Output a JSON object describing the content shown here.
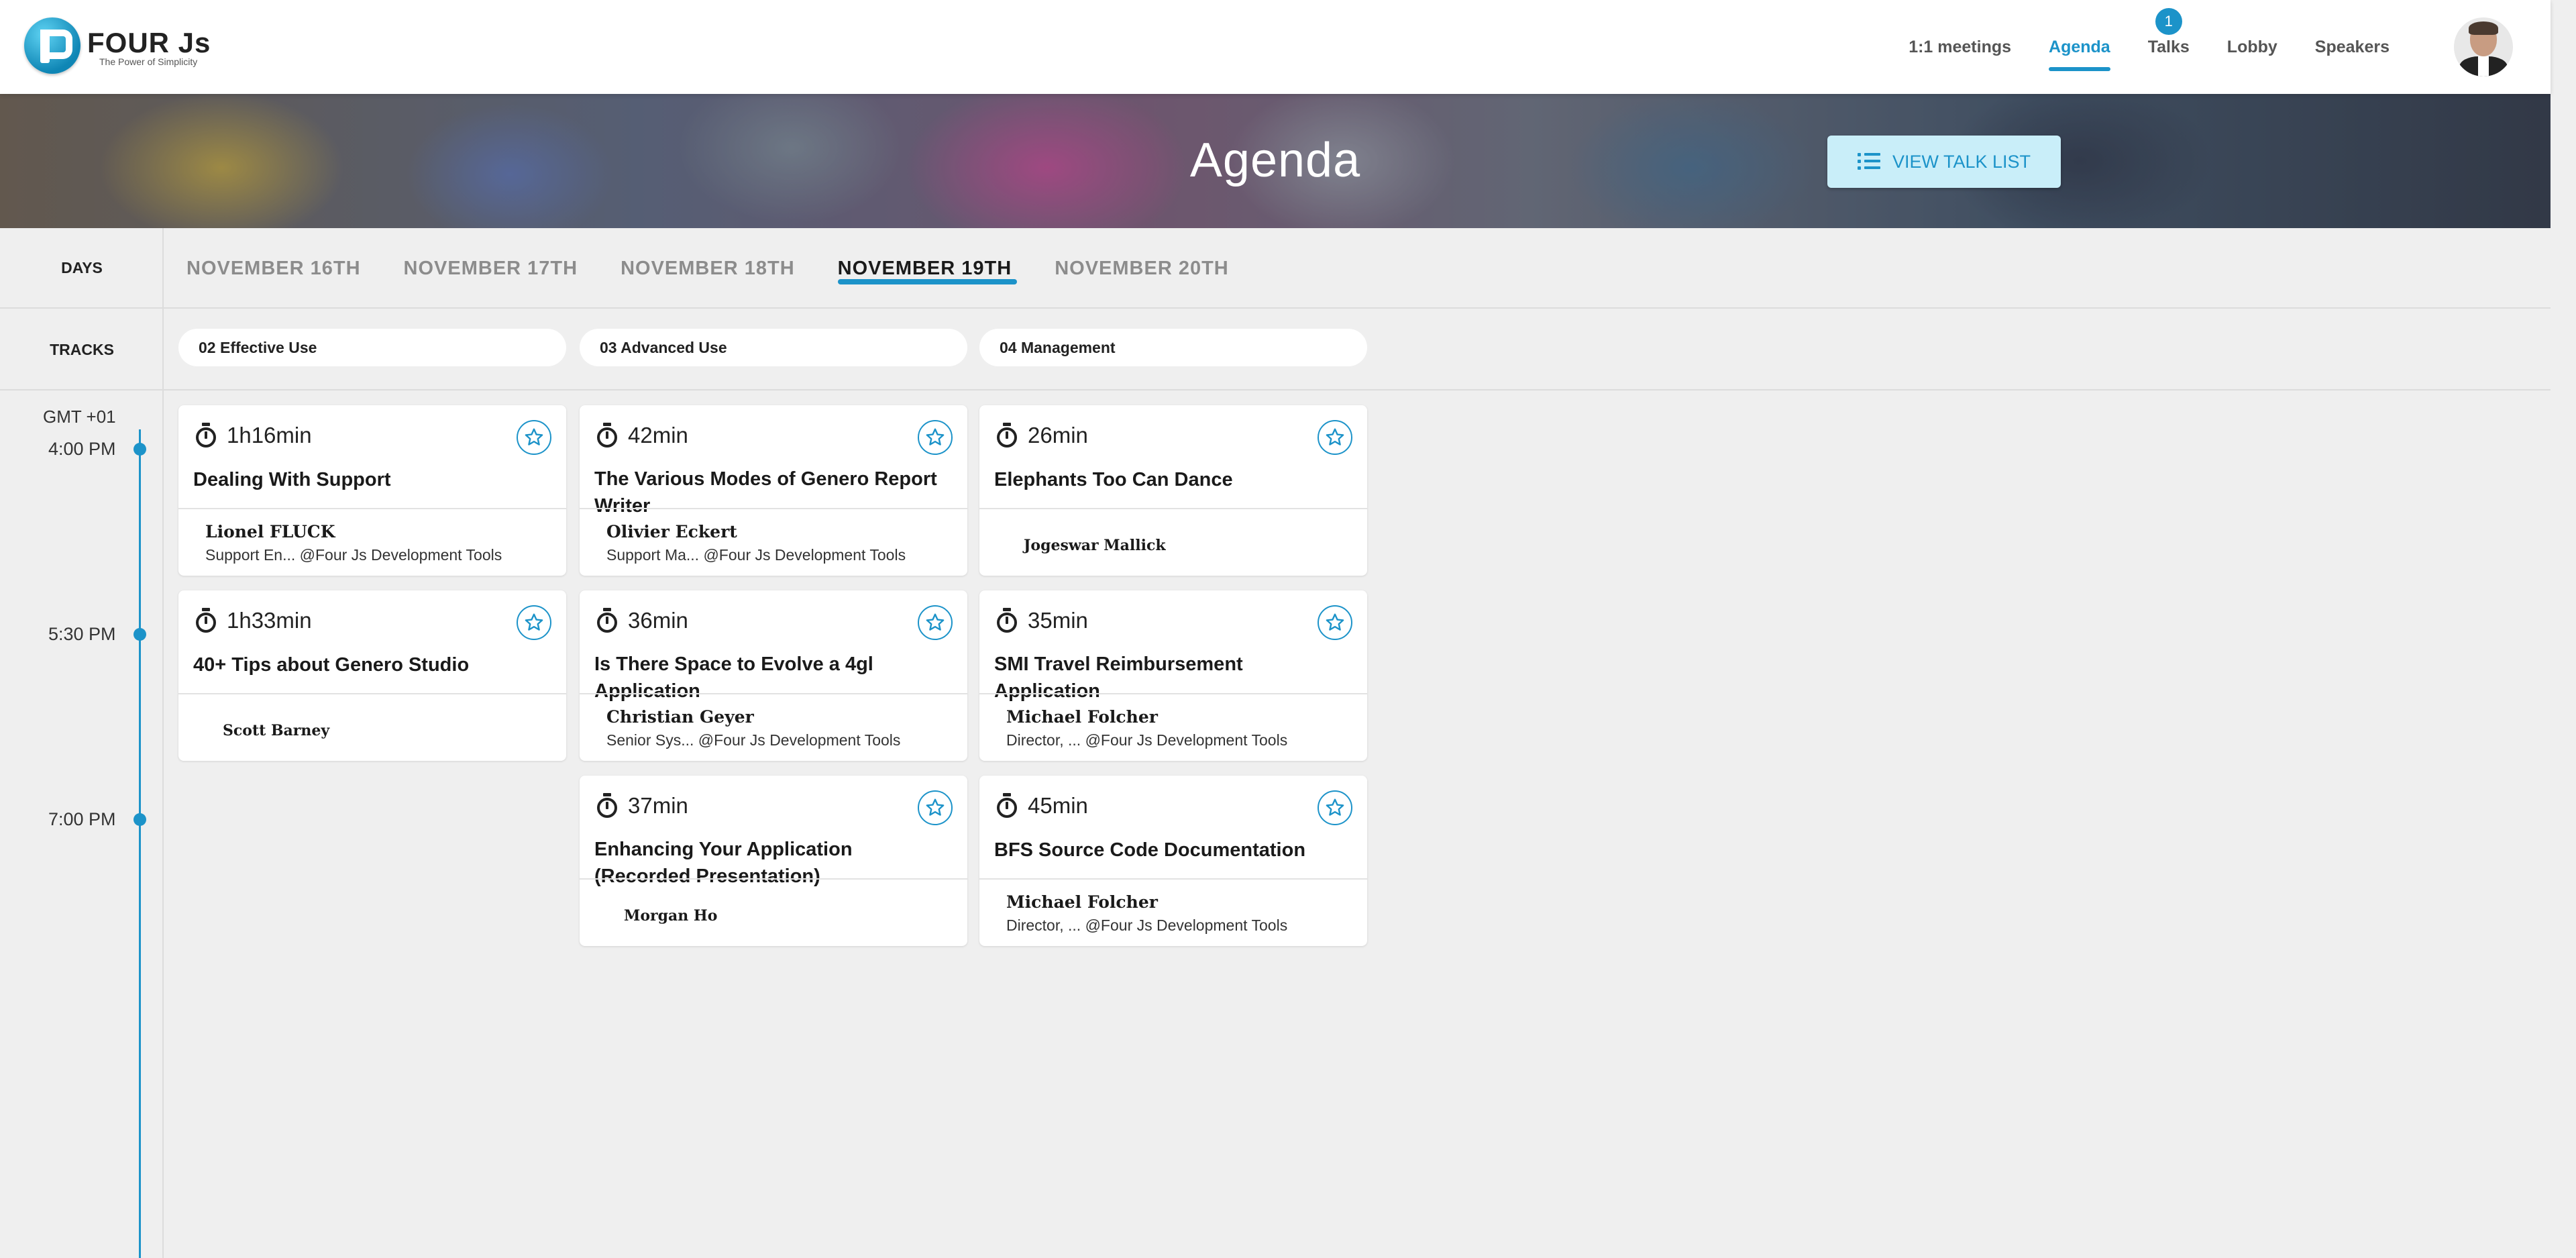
{
  "header": {
    "logo_text": "FOUR Js",
    "logo_tagline": "The Power of Simplicity",
    "nav": [
      {
        "label": "1:1 meetings",
        "active": false,
        "badge": null
      },
      {
        "label": "Agenda",
        "active": true,
        "badge": null
      },
      {
        "label": "Talks",
        "active": false,
        "badge": "1"
      },
      {
        "label": "Lobby",
        "active": false,
        "badge": null
      },
      {
        "label": "Speakers",
        "active": false,
        "badge": null
      }
    ],
    "accent_color": "#1c93c9"
  },
  "banner": {
    "title": "Agenda",
    "view_button_label": "VIEW TALK LIST"
  },
  "days": {
    "label": "DAYS",
    "tabs": [
      "NOVEMBER 16TH",
      "NOVEMBER 17TH",
      "NOVEMBER 18TH",
      "NOVEMBER 19TH",
      "NOVEMBER 20TH"
    ],
    "active": "NOVEMBER 19TH"
  },
  "tracks": {
    "label": "TRACKS",
    "items": [
      "02 Effective Use",
      "03 Advanced Use",
      "04 Management"
    ]
  },
  "timeline": {
    "timezone": "GMT +01",
    "slots": [
      "4:00 PM",
      "5:30 PM",
      "7:00 PM"
    ]
  },
  "sessions": [
    {
      "track": "02 Effective Use",
      "slot": "4:00 PM",
      "duration": "1h16min",
      "title": "Dealing With Support",
      "speaker": "Lionel FLUCK",
      "role": "Support En... @Four Js Development Tools"
    },
    {
      "track": "03 Advanced Use",
      "slot": "4:00 PM",
      "duration": "42min",
      "title": "The Various Modes of Genero Report Writer",
      "speaker": "Olivier Eckert",
      "role": "Support Ma... @Four Js Development Tools"
    },
    {
      "track": "04 Management",
      "slot": "4:00 PM",
      "duration": "26min",
      "title": "Elephants Too Can Dance",
      "speaker": "Jogeswar Mallick",
      "role": ""
    },
    {
      "track": "02 Effective Use",
      "slot": "5:30 PM",
      "duration": "1h33min",
      "title": "40+ Tips about Genero Studio",
      "speaker": "Scott Barney",
      "role": ""
    },
    {
      "track": "03 Advanced Use",
      "slot": "5:30 PM",
      "duration": "36min",
      "title": "Is There Space to Evolve a 4gl Application",
      "speaker": "Christian Geyer",
      "role": "Senior Sys... @Four Js Development Tools"
    },
    {
      "track": "04 Management",
      "slot": "5:30 PM",
      "duration": "35min",
      "title": "SMI Travel Reimbursement Application",
      "speaker": "Michael Folcher",
      "role": "Director, ... @Four Js Development Tools"
    },
    {
      "track": "03 Advanced Use",
      "slot": "7:00 PM",
      "duration": "37min",
      "title": "Enhancing Your Application (Recorded Presentation)",
      "speaker": "Morgan Ho",
      "role": ""
    },
    {
      "track": "04 Management",
      "slot": "7:00 PM",
      "duration": "45min",
      "title": "BFS Source Code Documentation",
      "speaker": "Michael Folcher",
      "role": "Director, ... @Four Js Development Tools"
    }
  ]
}
